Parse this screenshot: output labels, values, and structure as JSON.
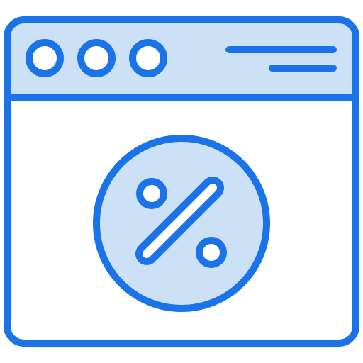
{
  "icon": {
    "name": "browser-window-percent-discount-icon",
    "stroke_color": "#1a73e8",
    "fill_color": "#cce0f6",
    "background_color": "#ffffff",
    "window_dots": [
      "dot-1",
      "dot-2",
      "dot-3"
    ],
    "symbol": "percent-sign-icon"
  }
}
